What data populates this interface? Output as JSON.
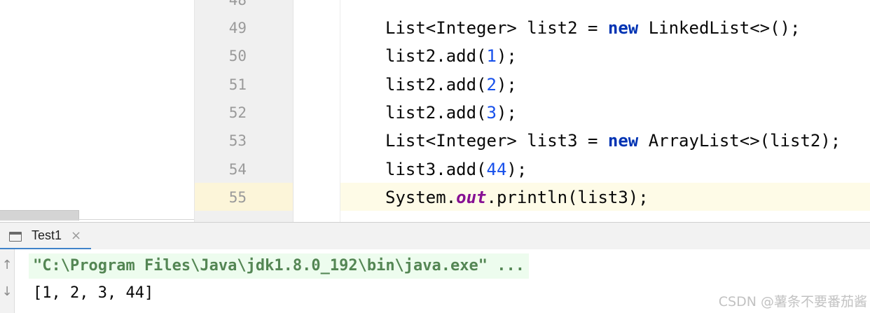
{
  "editor": {
    "partial_line_number": "48",
    "current_line_index": 6,
    "lines": [
      {
        "number": "49",
        "segments": [
          {
            "text": "List<Integer> list2 = ",
            "cls": "plain"
          },
          {
            "text": "new",
            "cls": "kw"
          },
          {
            "text": " LinkedList<>();",
            "cls": "plain"
          }
        ]
      },
      {
        "number": "50",
        "segments": [
          {
            "text": "list2.add(",
            "cls": "plain"
          },
          {
            "text": "1",
            "cls": "num"
          },
          {
            "text": ");",
            "cls": "plain"
          }
        ]
      },
      {
        "number": "51",
        "segments": [
          {
            "text": "list2.add(",
            "cls": "plain"
          },
          {
            "text": "2",
            "cls": "num"
          },
          {
            "text": ");",
            "cls": "plain"
          }
        ]
      },
      {
        "number": "52",
        "segments": [
          {
            "text": "list2.add(",
            "cls": "plain"
          },
          {
            "text": "3",
            "cls": "num"
          },
          {
            "text": ");",
            "cls": "plain"
          }
        ]
      },
      {
        "number": "53",
        "segments": [
          {
            "text": "List<Integer> list3 = ",
            "cls": "plain"
          },
          {
            "text": "new",
            "cls": "kw"
          },
          {
            "text": " ArrayList<>(list2);",
            "cls": "plain"
          }
        ]
      },
      {
        "number": "54",
        "segments": [
          {
            "text": "list3.add(",
            "cls": "plain"
          },
          {
            "text": "44",
            "cls": "num"
          },
          {
            "text": ");",
            "cls": "plain"
          }
        ]
      },
      {
        "number": "55",
        "segments": [
          {
            "text": "System.",
            "cls": "plain"
          },
          {
            "text": "out",
            "cls": "field"
          },
          {
            "text": ".println(list3);",
            "cls": "plain"
          }
        ]
      }
    ]
  },
  "run_window": {
    "tab_label": "Test1",
    "tab_close_glyph": "×",
    "toolbar_up_glyph": "↑",
    "toolbar_down_glyph": "↓",
    "command_line": "\"C:\\Program Files\\Java\\jdk1.8.0_192\\bin\\java.exe\" ...",
    "output": "[1, 2, 3, 44]"
  },
  "watermark": "CSDN @薯条不要番茄酱",
  "colors": {
    "keyword": "#0033b3",
    "number": "#1750eb",
    "static_field": "#871094",
    "current_line": "#fefbe7",
    "command_text": "#548654",
    "tab_underline": "#4083c9"
  }
}
